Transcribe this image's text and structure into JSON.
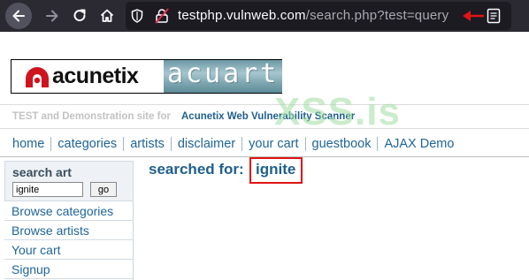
{
  "browser": {
    "url_host": "testphp.vulnweb.com",
    "url_path": "/search.php?test=query",
    "colors": {
      "toolbar": "#2b2a33",
      "urlbar": "#1c1b22",
      "annotation": "#e01414"
    }
  },
  "header": {
    "logo_brand": "acunetix",
    "logo_product": "acuart",
    "tagline_lead": "TEST and Demonstration site for",
    "tagline_highlight": "Acunetix Web Vulnerability Scanner",
    "watermark": "XSS.is"
  },
  "menu": [
    {
      "label": "home"
    },
    {
      "label": "categories"
    },
    {
      "label": "artists"
    },
    {
      "label": "disclaimer"
    },
    {
      "label": "your cart"
    },
    {
      "label": "guestbook"
    },
    {
      "label": "AJAX Demo"
    }
  ],
  "sidebar": {
    "search_title": "search art",
    "search_value": "ignite",
    "go_label": "go",
    "links": [
      {
        "label": "Browse categories"
      },
      {
        "label": "Browse artists"
      },
      {
        "label": "Your cart"
      },
      {
        "label": "Signup"
      }
    ]
  },
  "main": {
    "result_label": "searched for:",
    "result_value": "ignite"
  },
  "icons": [
    "back-arrow-icon",
    "forward-arrow-icon",
    "reload-icon",
    "home-icon",
    "shield-icon",
    "insecure-lock-icon",
    "red-arrow-icon",
    "reader-view-icon"
  ]
}
